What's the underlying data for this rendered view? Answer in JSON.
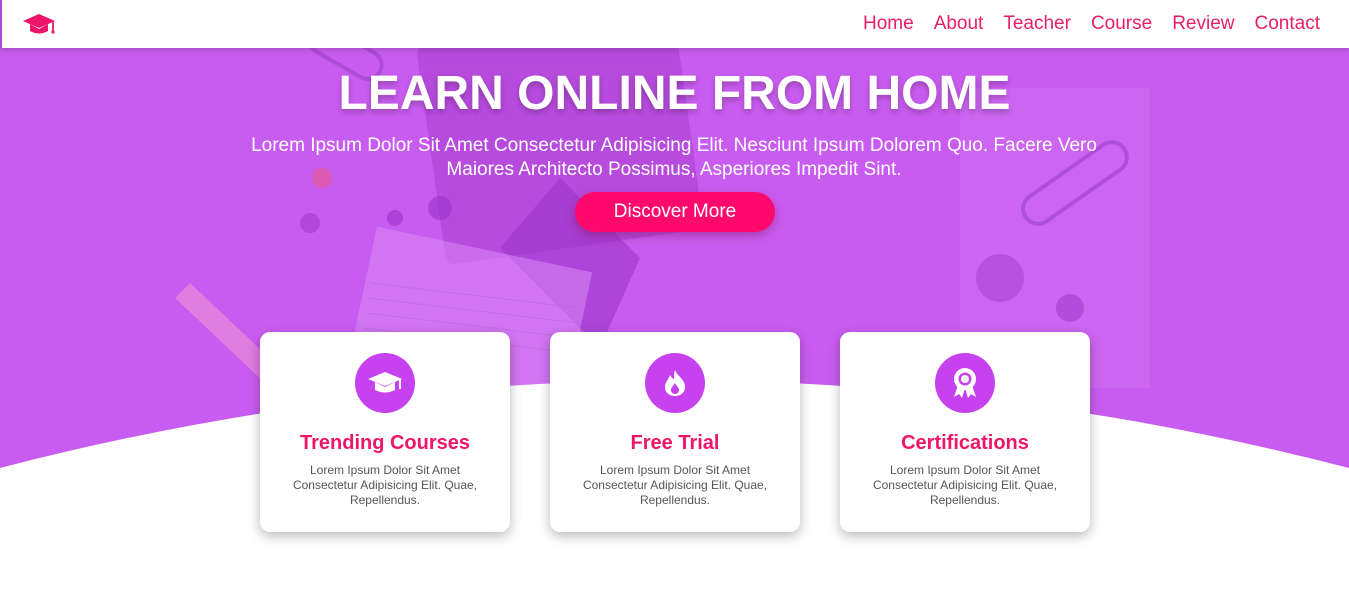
{
  "nav": {
    "logo_icon": "graduation-cap-icon",
    "links": [
      "Home",
      "About",
      "Teacher",
      "Course",
      "Review",
      "Contact"
    ]
  },
  "hero": {
    "title": "LEARN ONLINE FROM HOME",
    "subtitle": "Lorem Ipsum Dolor Sit Amet Consectetur Adipisicing Elit. Nesciunt Ipsum Dolorem Quo. Facere Vero Maiores Architecto Possimus, Asperiores Impedit Sint.",
    "cta_label": "Discover More"
  },
  "features": [
    {
      "icon": "graduation-cap-icon",
      "title": "Trending Courses",
      "text": "Lorem Ipsum Dolor Sit Amet Consectetur Adipisicing Elit. Quae, Repellendus."
    },
    {
      "icon": "fire-icon",
      "title": "Free Trial",
      "text": "Lorem Ipsum Dolor Sit Amet Consectetur Adipisicing Elit. Quae, Repellendus."
    },
    {
      "icon": "award-icon",
      "title": "Certifications",
      "text": "Lorem Ipsum Dolor Sit Amet Consectetur Adipisicing Elit. Quae, Repellendus."
    }
  ],
  "colors": {
    "accent": "#e91e63",
    "cta": "#ff0a6c",
    "hero_bg": "#c95cf0",
    "icon_circle": "#c742ef"
  }
}
